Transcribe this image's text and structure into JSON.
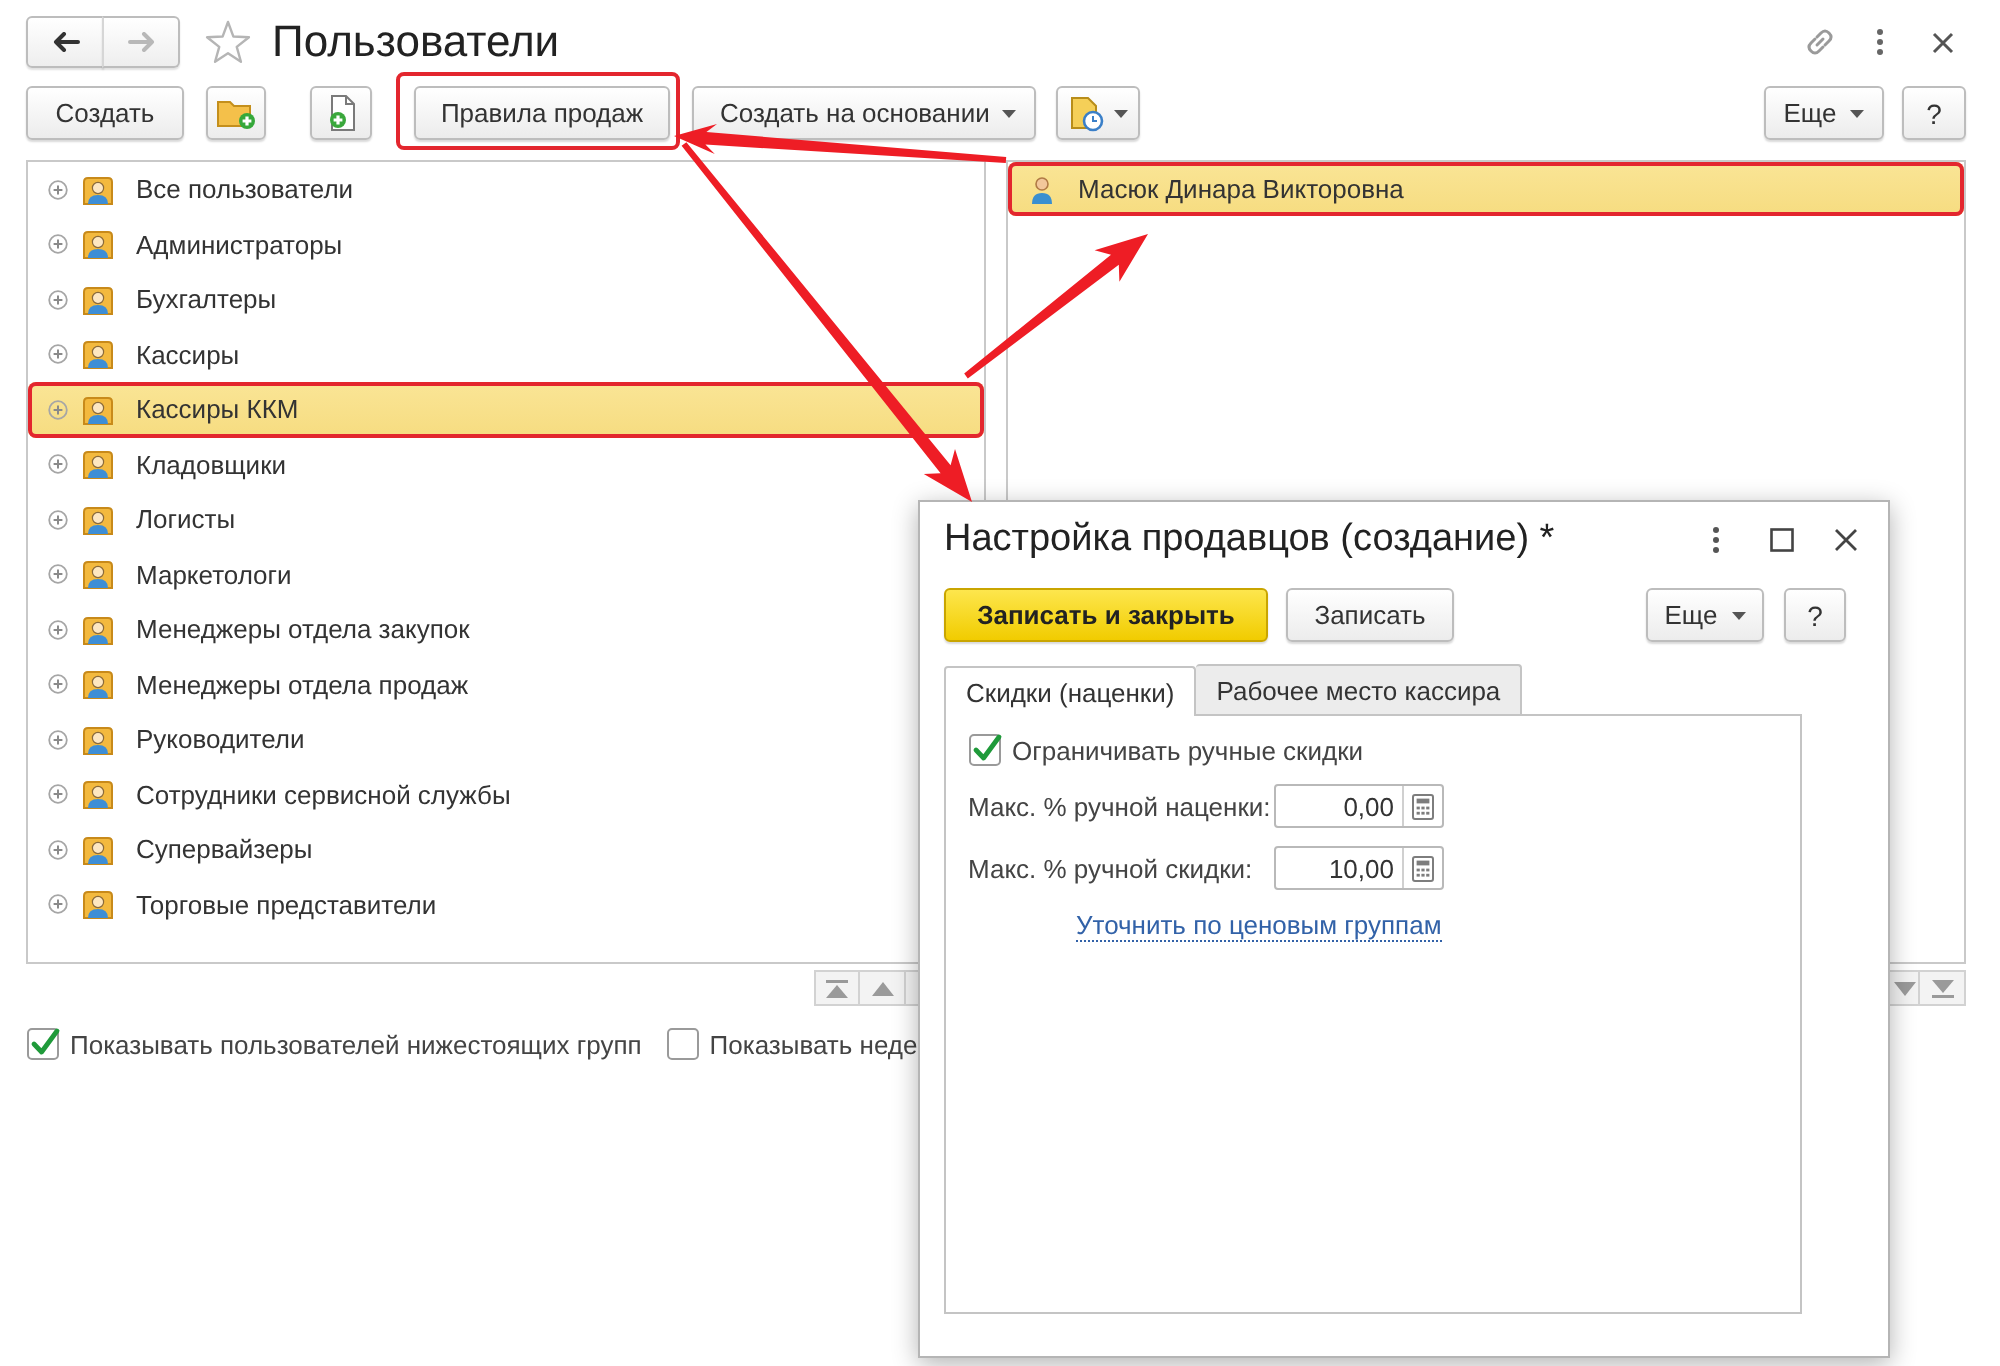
{
  "window": {
    "title": "Пользователи",
    "favorite": false
  },
  "nav_buttons": [
    {
      "kind": "back",
      "disabled": false
    },
    {
      "kind": "forward",
      "disabled": true
    }
  ],
  "toolbar": {
    "create": "Создать",
    "sales_rules": {
      "label": "Правила продаж",
      "highlighted": true
    },
    "create_based_on": "Создать на основании",
    "more": "Еще",
    "help": "?"
  },
  "groups": [
    {
      "label": "Все пользователи",
      "expanded": false,
      "selected": false,
      "highlighted": false
    },
    {
      "label": "Администраторы",
      "expanded": false,
      "selected": false,
      "highlighted": false
    },
    {
      "label": "Бухгалтеры",
      "expanded": false,
      "selected": false,
      "highlighted": false
    },
    {
      "label": "Кассиры",
      "expanded": false,
      "selected": false,
      "highlighted": false
    },
    {
      "label": "Кассиры ККМ",
      "expanded": false,
      "selected": true,
      "highlighted": true
    },
    {
      "label": "Кладовщики",
      "expanded": false,
      "selected": false,
      "highlighted": false
    },
    {
      "label": "Логисты",
      "expanded": false,
      "selected": false,
      "highlighted": false
    },
    {
      "label": "Маркетологи",
      "expanded": false,
      "selected": false,
      "highlighted": false
    },
    {
      "label": "Менеджеры отдела закупок",
      "expanded": false,
      "selected": false,
      "highlighted": false
    },
    {
      "label": "Менеджеры отдела продаж",
      "expanded": false,
      "selected": false,
      "highlighted": false
    },
    {
      "label": "Руководители",
      "expanded": false,
      "selected": false,
      "highlighted": false
    },
    {
      "label": "Сотрудники сервисной службы",
      "expanded": false,
      "selected": false,
      "highlighted": false
    },
    {
      "label": "Супервайзеры",
      "expanded": false,
      "selected": false,
      "highlighted": false
    },
    {
      "label": "Торговые представители",
      "expanded": false,
      "selected": false,
      "highlighted": false
    }
  ],
  "users": [
    {
      "name": "Масюк Динара Викторовна",
      "selected": true,
      "highlighted": true
    }
  ],
  "options": [
    {
      "label": "Показывать пользователей нижестоящих групп",
      "checked": true
    },
    {
      "label": "Показывать неде",
      "checked": false
    }
  ],
  "dialog": {
    "title": "Настройка продавцов (создание) *",
    "buttons": [
      {
        "label": "Записать и закрыть",
        "default": true
      },
      {
        "label": "Записать",
        "default": false
      }
    ],
    "more": "Еще",
    "help": "?",
    "tabs": [
      {
        "label": "Скидки (наценки)",
        "selected": true
      },
      {
        "label": "Рабочее место кассира",
        "selected": false
      }
    ],
    "limit_manual_discounts": {
      "label": "Ограничивать ручные скидки",
      "checked": true
    },
    "fields": [
      {
        "label": "Макс. % ручной наценки:",
        "value": "0,00"
      },
      {
        "label": "Макс. % ручной скидки:",
        "value": "10,00"
      }
    ],
    "link": "Уточнить по ценовым группам"
  }
}
